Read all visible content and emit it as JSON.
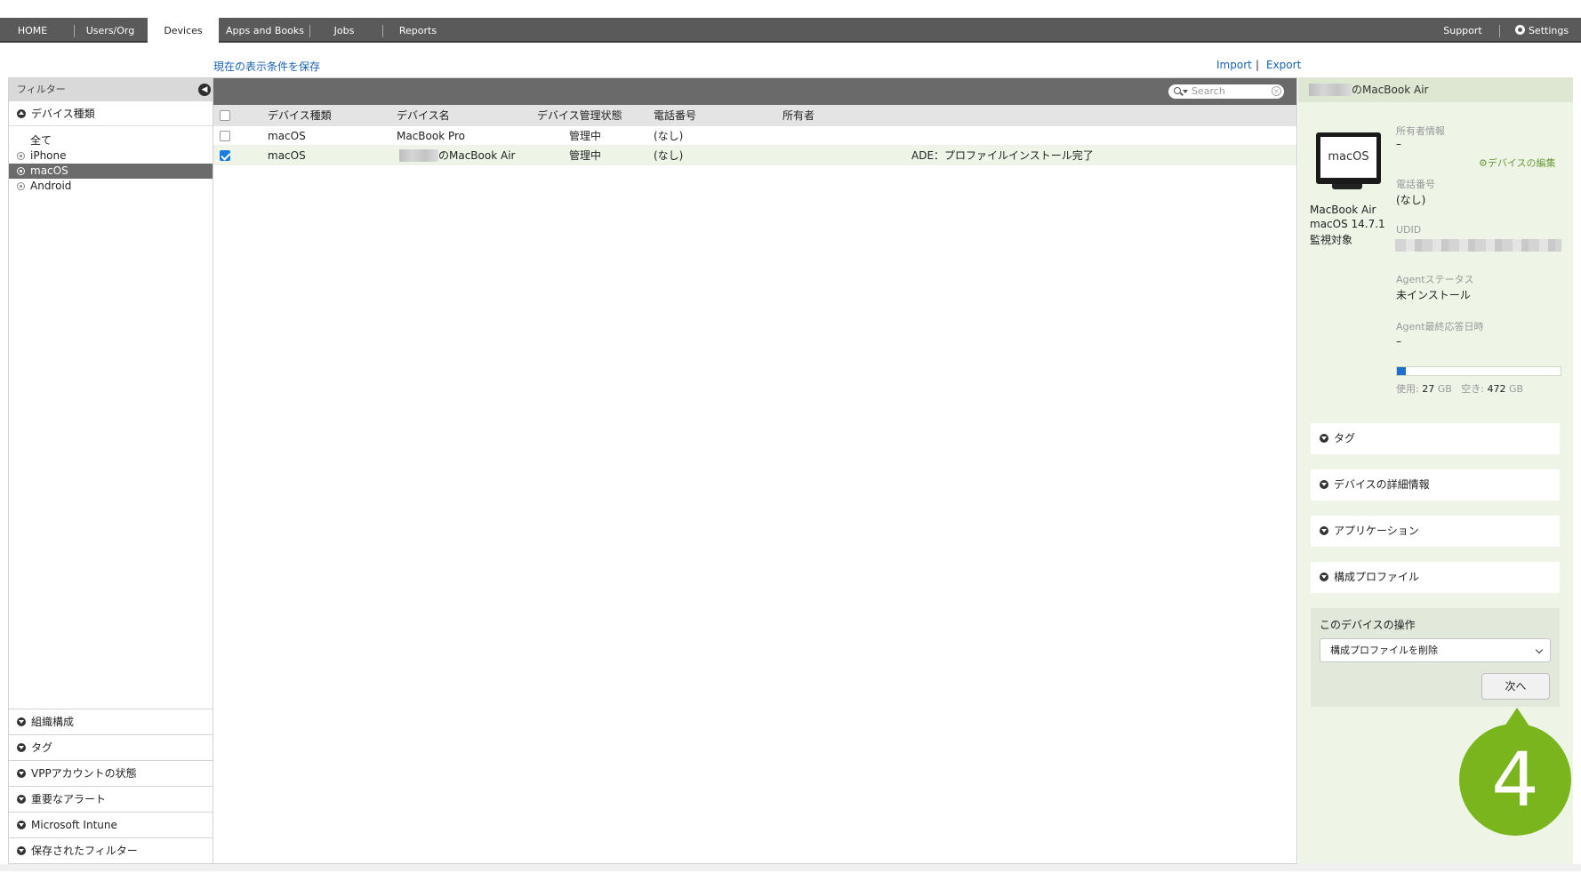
{
  "nav": {
    "tabs": [
      "HOME",
      "Users/Org",
      "Devices",
      "Apps and Books",
      "Jobs",
      "Reports"
    ],
    "active_tab": "Devices",
    "support": "Support",
    "settings": "Settings"
  },
  "toolbar": {
    "save_view": "現在の表示条件を保存",
    "import": "Import",
    "separator": "|",
    "export": "Export"
  },
  "filter": {
    "title": "フィルター",
    "device_type_heading": "デバイス種類",
    "types": [
      "全て",
      "iPhone",
      "macOS",
      "Android"
    ],
    "selected_type": "macOS",
    "sections": [
      "組織構成",
      "タグ",
      "VPPアカウントの状態",
      "重要なアラート",
      "Microsoft Intune",
      "保存されたフィルター"
    ]
  },
  "search": {
    "placeholder": "Search"
  },
  "table": {
    "columns": [
      "デバイス種類",
      "デバイス名",
      "デバイス管理状態",
      "電話番号",
      "所有者"
    ],
    "rows": [
      {
        "checked": false,
        "type": "macOS",
        "name": "MacBook Pro",
        "status": "管理中",
        "phone": "(なし)",
        "owner": "",
        "note": ""
      },
      {
        "checked": true,
        "type": "macOS",
        "name": "のMacBook Air",
        "status": "管理中",
        "phone": "(なし)",
        "owner": "",
        "note": "ADE：プロファイルインストール完了"
      }
    ]
  },
  "detail": {
    "title": "のMacBook Air",
    "device_icon_label": "macOS",
    "model": "MacBook Air",
    "os": "macOS 14.7.1",
    "supervised": "監視対象",
    "edit_link": "デバイスの編集",
    "owner_label": "所有者情報",
    "owner_value": "–",
    "phone_label": "電話番号",
    "phone_value": "(なし)",
    "udid_label": "UDID",
    "agent_status_label": "Agentステータス",
    "agent_status_value": "未インストール",
    "agent_last_label": "Agent最終応答日時",
    "agent_last_value": "–",
    "storage_used_label": "使用:",
    "storage_used": "27",
    "storage_free_label": "空き:",
    "storage_free": "472",
    "storage_unit": "GB",
    "storage_used_fraction": 0.054,
    "cards": [
      "タグ",
      "デバイスの詳細情報",
      "アプリケーション",
      "構成プロファイル"
    ],
    "operation_title": "このデバイスの操作",
    "operation_selected": "構成プロファイルを削除",
    "next_button": "次へ"
  },
  "callout": {
    "step": "4",
    "color": "#7ab51d"
  }
}
